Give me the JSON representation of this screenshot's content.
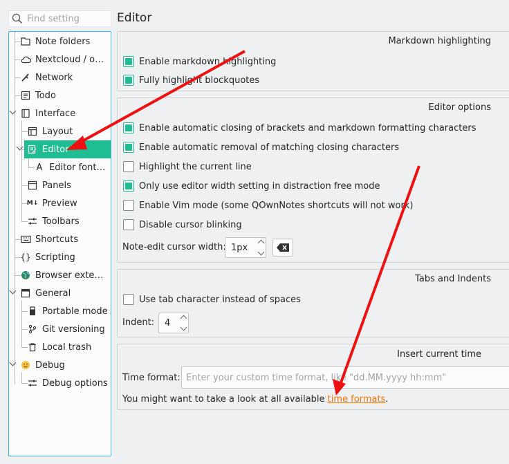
{
  "search": {
    "placeholder": "Find setting"
  },
  "page_title": "Editor",
  "tree": {
    "note_folders": "Note folders",
    "nextcloud": "Nextcloud / ow...",
    "network": "Network",
    "todo": "Todo",
    "interface": "Interface",
    "layout": "Layout",
    "editor": "Editor",
    "editor_fonts": "Editor fonts ...",
    "panels": "Panels",
    "preview": "Preview",
    "toolbars": "Toolbars",
    "shortcuts": "Shortcuts",
    "scripting": "Scripting",
    "browser_extension": "Browser extensi...",
    "general": "General",
    "portable_mode": "Portable mode",
    "git_versioning": "Git versioning",
    "local_trash": "Local trash",
    "debug": "Debug",
    "debug_options": "Debug options"
  },
  "markdown_group": {
    "title": "Markdown highlighting",
    "enable_highlighting": "Enable markdown highlighting",
    "highlight_blockquotes": "Fully highlight blockquotes"
  },
  "editor_group": {
    "title": "Editor options",
    "auto_close": "Enable automatic closing of brackets and markdown formatting characters",
    "auto_remove": "Enable automatic removal of matching closing characters",
    "highlight_line": "Highlight the current line",
    "width_distraction": "Only use editor width setting in distraction free mode",
    "vim_mode": "Enable Vim mode (some QOwnNotes shortcuts will not work)",
    "disable_blink": "Disable cursor blinking",
    "cursor_width_label": "Note-edit cursor width:",
    "cursor_width_value": "1px"
  },
  "tabs_group": {
    "title": "Tabs and Indents",
    "use_tab": "Use tab character instead of spaces",
    "indent_label": "Indent:",
    "indent_value": "4"
  },
  "time_group": {
    "title": "Insert current time",
    "format_label": "Time format:",
    "format_placeholder": "Enter your custom time format, like \"dd.MM.yyyy hh:mm\"",
    "hint_prefix": "You might want to take a look at all available",
    "hint_link": "time formats",
    "hint_suffix": "."
  },
  "colors": {
    "accent": "#1fbe92",
    "focus_border": "#3daee9",
    "link": "#f67400",
    "annotation": "#ee1111"
  }
}
